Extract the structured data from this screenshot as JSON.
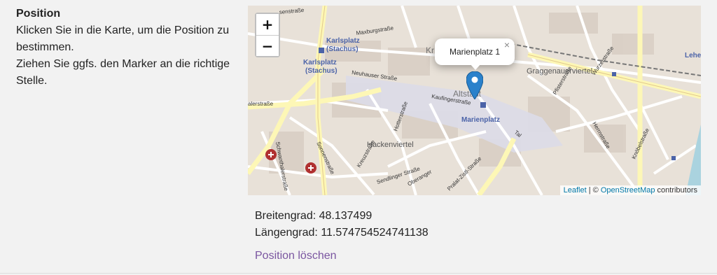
{
  "section": {
    "title": "Position",
    "instruction_line1": "Klicken Sie in die Karte, um die Position zu bestimmen.",
    "instruction_line2": "Ziehen Sie ggfs. den Marker an die richtige Stelle."
  },
  "map": {
    "zoom_in_label": "+",
    "zoom_out_label": "−",
    "popup_text": "Marienplatz 1",
    "popup_close": "×",
    "labels": {
      "karlsplatz_1": "Karlsplatz",
      "karlsplatz_2": "(Stachus)",
      "karlsplatz_3": "Karlsplatz",
      "karlsplatz_4": "(Stachus)",
      "maxburgstrasse": "Maxburgstraße",
      "neuhauser": "Neuhauser Straße",
      "kaufinger": "Kaufingerstraße",
      "altstadt": "Altstadt",
      "marienplatz": "Marienplatz",
      "graggenauer": "Graggenauerviertel",
      "hackenviertel": "Hackenviertel",
      "sonnenstrasse": "Sonnenstraße",
      "sendlinger": "Sendlinger Straße",
      "oberanger": "Oberanger",
      "hotterstrasse": "Hotterstraße",
      "kreuzstrasse": "Kreuzstraße",
      "tal": "Tal",
      "herrnstrasse": "Herrnstraße",
      "pfisterstrasse": "Pfisterstraße",
      "wurzerstrasse": "Wurzerstraße",
      "knoebelstrasse": "Knöbelstraße",
      "lehel": "Lehel",
      "senstrasse": "senstraße",
      "alerstrasse": "alerstraße",
      "schwanthaler": "Schwanthalerstraße",
      "kr": "Kr",
      "zost": "Pralat-Zistl-Straße"
    },
    "attribution": {
      "leaflet": "Leaflet",
      "separator": " | © ",
      "osm": "OpenStreetMap",
      "contributors": " contributors"
    },
    "colors": {
      "land": "#e8e1d8",
      "road_major": "#fdf7b6",
      "road_minor": "#ffffff",
      "pedestrian": "#dcdbe8",
      "marker": "#2a81cb",
      "label_blue": "#4b63a8"
    }
  },
  "coordinates": {
    "lat_label": "Breitengrad: ",
    "lat_value": "48.137499",
    "lng_label": "Längengrad: ",
    "lng_value": "11.574754524741138"
  },
  "actions": {
    "clear_position": "Position löschen"
  }
}
